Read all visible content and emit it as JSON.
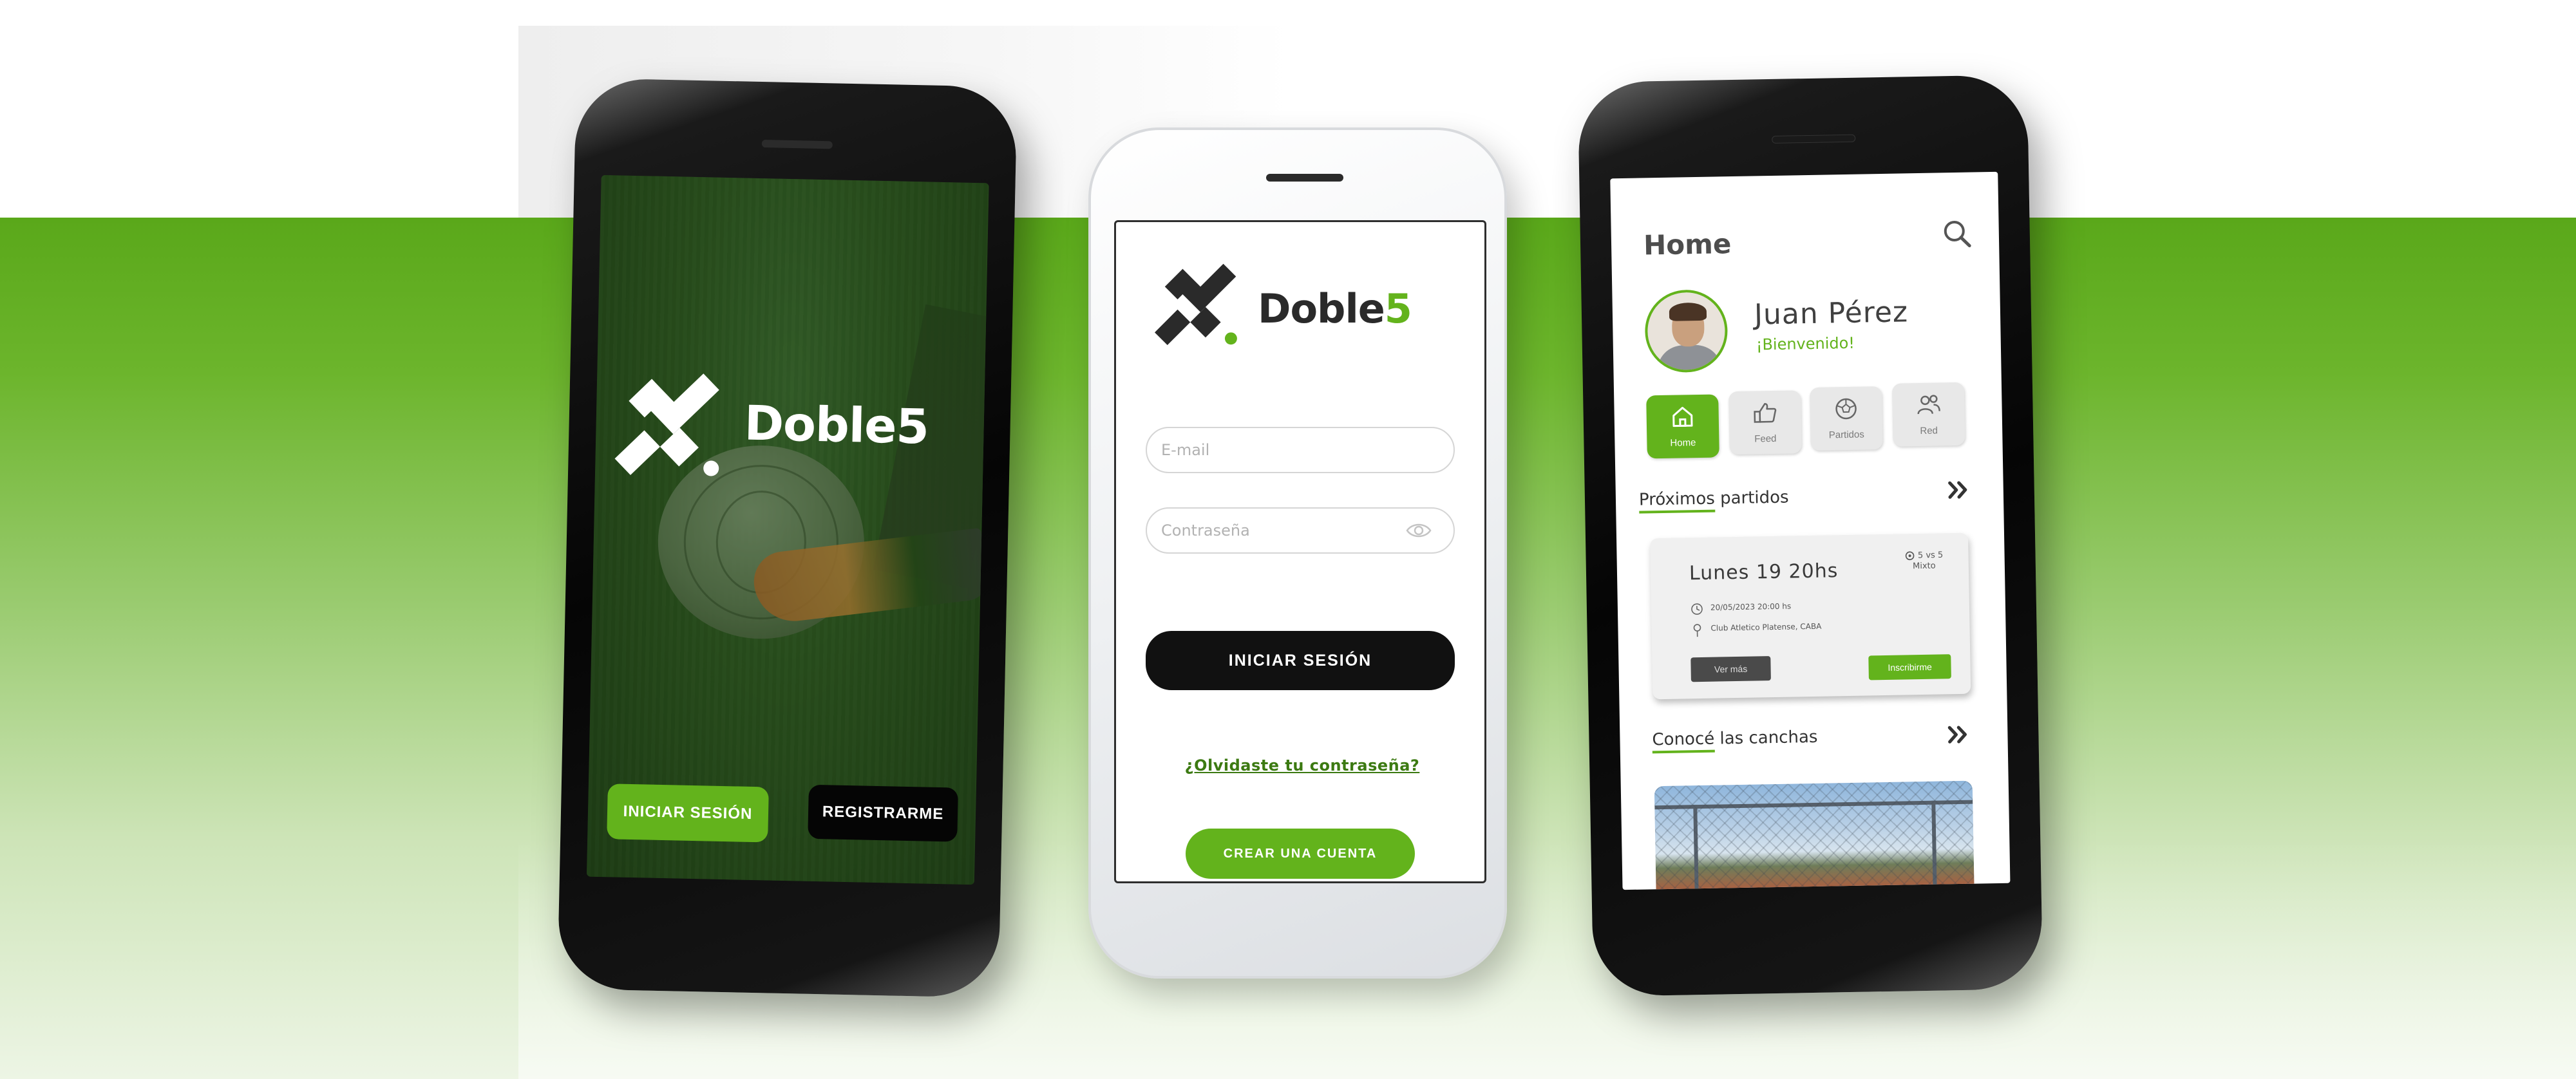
{
  "brand": {
    "name": "Doble",
    "number": "5",
    "green": "#63b31c",
    "dark": "#111111"
  },
  "welcome_screen": {
    "logo_text": "Doble5",
    "login_button": "INICIAR SESIÓN",
    "register_button": "REGISTRARME"
  },
  "login_screen": {
    "logo_name": "Doble",
    "logo_number": "5",
    "email_placeholder": "E-mail",
    "password_placeholder": "Contraseña",
    "login_button": "INICIAR SESIÓN",
    "forgot_link": "¿Olvidaste tu contraseña?",
    "create_account_button": "CREAR UNA CUENTA"
  },
  "home_screen": {
    "title": "Home",
    "user_name": "Juan Pérez",
    "welcome": "¡Bienvenido!",
    "nav": [
      {
        "label": "Home",
        "icon": "house-icon",
        "active": true
      },
      {
        "label": "Feed",
        "icon": "thumbs-up-icon",
        "active": false
      },
      {
        "label": "Partidos",
        "icon": "soccer-ball-icon",
        "active": false
      },
      {
        "label": "Red",
        "icon": "people-icon",
        "active": false
      }
    ],
    "upcoming": {
      "title_underlined": "Próximos",
      "title_rest": "partidos"
    },
    "match": {
      "title": "Lunes 19 20hs",
      "type_line1": "5 vs 5",
      "type_line2": "Mixto",
      "datetime": "20/05/2023 20:00 hs",
      "location": "Club Atletico Platense, CABA",
      "more_button": "Ver más",
      "signup_button": "Inscribirme"
    },
    "courts": {
      "title_underlined": "Conocé",
      "title_rest": "las canchas"
    }
  }
}
